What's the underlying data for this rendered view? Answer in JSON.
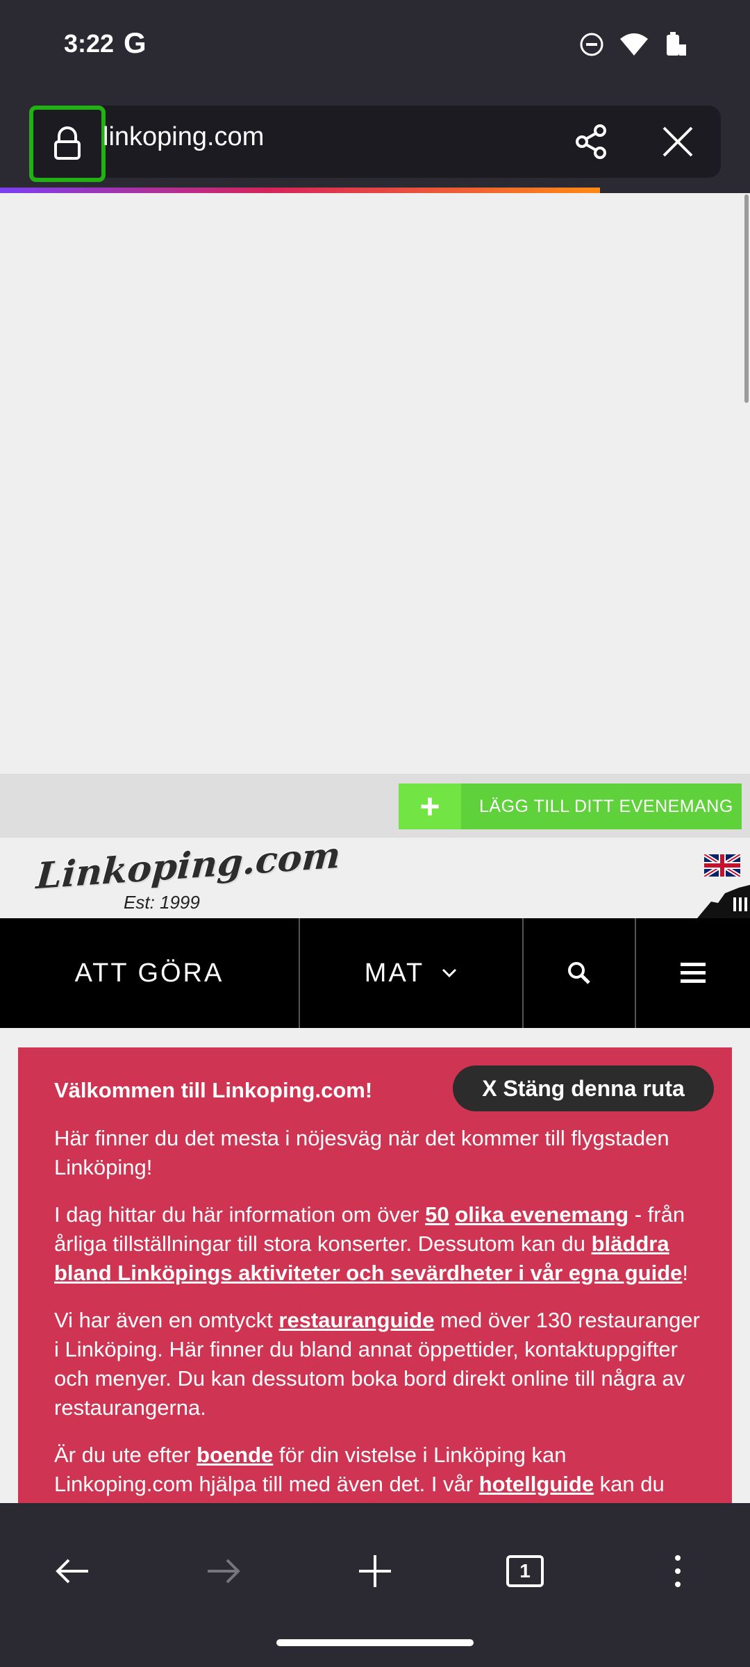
{
  "status_bar": {
    "time": "3:22",
    "g_logo": "G"
  },
  "browser": {
    "url": "linkoping.com",
    "lock_icon": "lock-icon",
    "share_icon": "share-icon",
    "close_icon": "close-icon"
  },
  "page": {
    "add_event": {
      "plus": "+",
      "label": "LÄGG TILL DITT EVENEMANG"
    },
    "logo": {
      "text": "Linkoping.com",
      "sub": "Est: 1999"
    },
    "nav": {
      "items": [
        {
          "label": "ATT GÖRA"
        },
        {
          "label": "MAT"
        }
      ]
    },
    "welcome": {
      "title": "Välkommen till Linkoping.com!",
      "close_label": "X Stäng denna ruta",
      "p1": "Här finner du det mesta i nöjesväg när det kommer till flygstaden Linköping!",
      "p2_pre": "I dag hittar du här information om över ",
      "p2_link1": "50",
      "p2_space": " ",
      "p2_link2": "olika evenemang",
      "p2_mid": " - från årliga tillställningar till stora konserter. Dessutom kan du ",
      "p2_link3": "bläddra bland Linköpings aktiviteter och sevärdheter i vår egna guide",
      "p2_post": "!",
      "p3_pre": "Vi har även en omtyckt ",
      "p3_link": "restauranguide",
      "p3_post": " med över 130 restauranger i Linköping. Här finner du bland annat öppettider, kontaktuppgifter och menyer. Du kan dessutom boka bord direkt online till några av restaurangerna.",
      "p4_pre": "Är du ute efter ",
      "p4_link1": "boende",
      "p4_mid": " för din vistelse i Linköping kan Linkoping.com hjälpa till med även det. I vår ",
      "p4_link2": "hotellguide",
      "p4_post": " kan du"
    }
  },
  "toolbar": {
    "tab_count": "1"
  },
  "colors": {
    "accent_green": "#5fd13a",
    "welcome_red": "#cf3553",
    "lock_highlight": "#22b014"
  }
}
